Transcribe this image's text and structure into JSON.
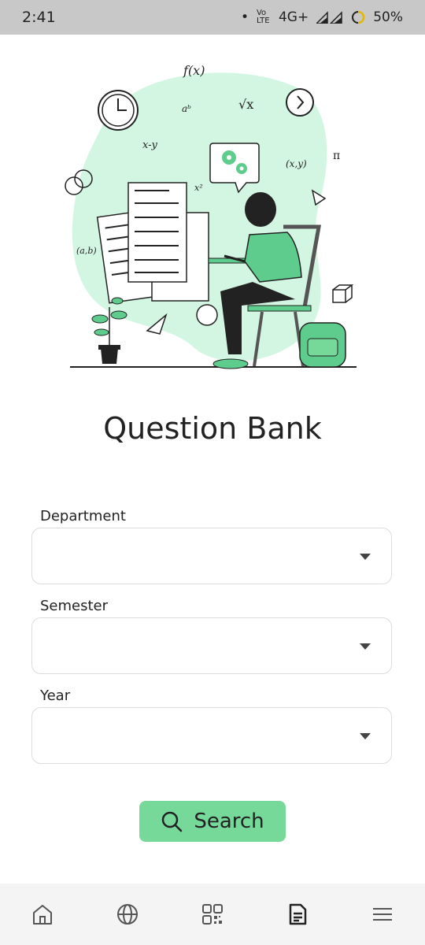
{
  "status_bar": {
    "time": "2:41",
    "dot": "•",
    "volte": "Vo LTE",
    "network": "4G+",
    "battery": "50%"
  },
  "page": {
    "title": "Question Bank"
  },
  "form": {
    "department": {
      "label": "Department",
      "value": ""
    },
    "semester": {
      "label": "Semester",
      "value": ""
    },
    "year": {
      "label": "Year",
      "value": ""
    },
    "search_label": "Search"
  },
  "bottom_nav": {
    "items": [
      {
        "icon": "home-icon"
      },
      {
        "icon": "globe-icon"
      },
      {
        "icon": "qr-code-icon"
      },
      {
        "icon": "document-icon",
        "active": true
      },
      {
        "icon": "menu-icon"
      }
    ]
  },
  "colors": {
    "accent": "#76d99a",
    "blob": "#d3f6e3",
    "status_bar": "#c8c8c8"
  }
}
